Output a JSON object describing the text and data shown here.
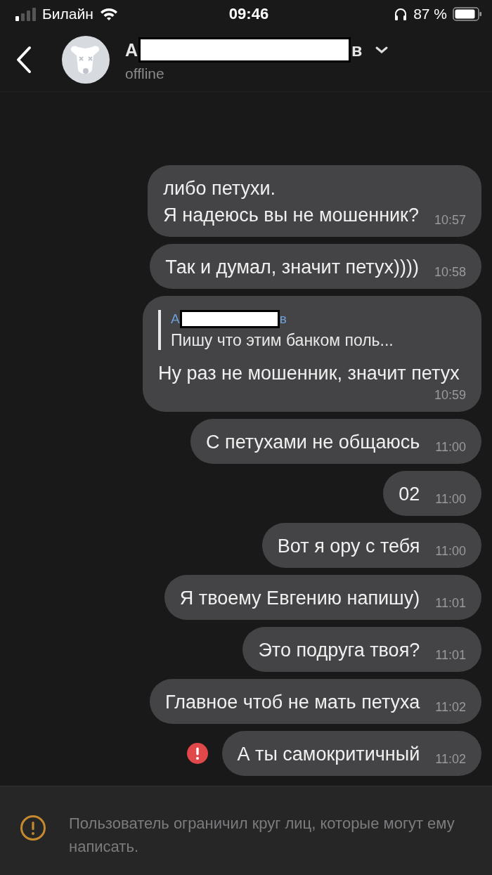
{
  "status_bar": {
    "carrier": "Билайн",
    "time": "09:46",
    "battery": "87 %"
  },
  "header": {
    "name_start": "А",
    "name_end": "в",
    "name_redacted": true,
    "status": "offline"
  },
  "messages": [
    {
      "kind": "text",
      "lines": "либо петухи.\nЯ надеюсь вы не мошенник?",
      "time": "10:57",
      "failed": false
    },
    {
      "kind": "text",
      "lines": "Так и думал, значит петух))))",
      "time": "10:58",
      "failed": false
    },
    {
      "kind": "reply",
      "quote_name_start": "А",
      "quote_name_end": "в",
      "quote_redacted": true,
      "quote_text": "Пишу что этим банком поль...",
      "lines": "Ну раз не мошенник, значит петух",
      "time": "10:59",
      "failed": false
    },
    {
      "kind": "text",
      "lines": "С петухами не общаюсь",
      "time": "11:00",
      "failed": false
    },
    {
      "kind": "text",
      "lines": "02",
      "time": "11:00",
      "failed": false
    },
    {
      "kind": "text",
      "lines": "Вот я ору с тебя",
      "time": "11:00",
      "failed": false
    },
    {
      "kind": "text",
      "lines": "Я твоему Евгению напишу)",
      "time": "11:01",
      "failed": false
    },
    {
      "kind": "text",
      "lines": "Это подруга твоя?",
      "time": "11:01",
      "failed": false
    },
    {
      "kind": "text",
      "lines": "Главное чтоб не мать петуха",
      "time": "11:02",
      "failed": false
    },
    {
      "kind": "text",
      "lines": "А ты самокритичный",
      "time": "11:02",
      "failed": true
    }
  ],
  "notice": {
    "text": "Пользователь ограничил круг лиц, которые могут ему написать."
  }
}
